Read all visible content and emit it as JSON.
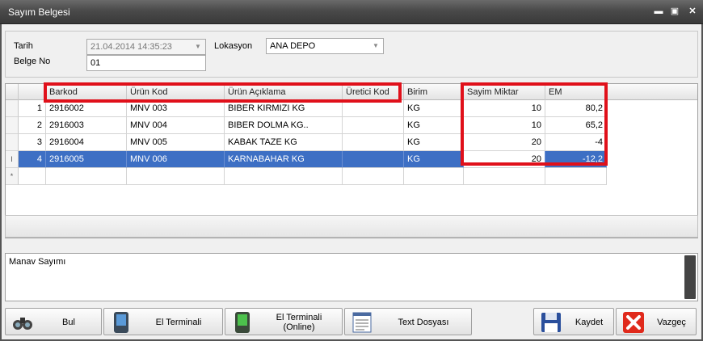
{
  "window": {
    "title": "Sayım Belgesi"
  },
  "header": {
    "date_label": "Tarih",
    "date_value": "21.04.2014 14:35:23",
    "doc_label": "Belge No",
    "doc_value": "01",
    "location_label": "Lokasyon",
    "location_value": "ANA DEPO"
  },
  "grid": {
    "columns": [
      "Barkod",
      "Ürün Kod",
      "Ürün Açıklama",
      "Üretici Kod",
      "Birim",
      "Sayim Miktar",
      "EM"
    ],
    "rows": [
      {
        "no": "1",
        "barkod": "2916002",
        "urun_kod": "MNV 003",
        "aciklama": "BIBER KIRMIZI KG",
        "uretici": "",
        "birim": "KG",
        "miktar": "10",
        "em": "80,2"
      },
      {
        "no": "2",
        "barkod": "2916003",
        "urun_kod": "MNV 004",
        "aciklama": "BIBER DOLMA KG..",
        "uretici": "",
        "birim": "KG",
        "miktar": "10",
        "em": "65,2"
      },
      {
        "no": "3",
        "barkod": "2916004",
        "urun_kod": "MNV 005",
        "aciklama": "KABAK TAZE KG",
        "uretici": "",
        "birim": "KG",
        "miktar": "20",
        "em": "-4"
      },
      {
        "no": "4",
        "barkod": "2916005",
        "urun_kod": "MNV 006",
        "aciklama": "KARNABAHAR KG",
        "uretici": "",
        "birim": "KG",
        "miktar": "20",
        "em": "-12,2"
      }
    ],
    "new_row_marker": "*",
    "edit_marker": "I"
  },
  "note": {
    "text": "Manav Sayımı"
  },
  "buttons": {
    "find": "Bul",
    "terminal": "El Terminali",
    "terminal_online_1": "El Terminali",
    "terminal_online_2": "(Online)",
    "text_file": "Text Dosyası",
    "save": "Kaydet",
    "cancel": "Vazgeç"
  },
  "colors": {
    "selection": "#3d6fc4",
    "highlight": "#e0101a",
    "titlebar": "#4a4a4a"
  }
}
